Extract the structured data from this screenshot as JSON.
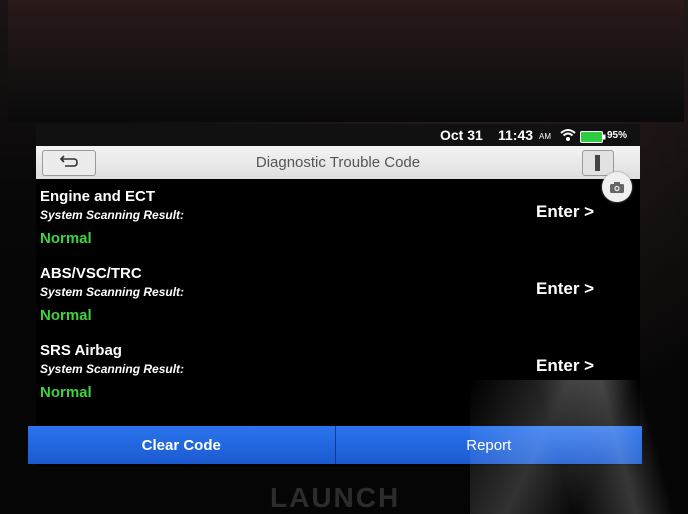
{
  "status": {
    "date": "Oct 31",
    "time": "11:43",
    "ampm": "AM",
    "battery": "95%",
    "wifi_icon": "wifi-icon",
    "battery_icon": "battery-icon"
  },
  "header": {
    "title": "Diagnostic Trouble Code",
    "back_icon": "back-arrow-icon",
    "menu_icon": "menu-icon",
    "camera_icon": "camera-icon"
  },
  "systems": [
    {
      "name": "Engine and ECT",
      "scan_label": "System Scanning Result:",
      "status": "Normal",
      "enter": "Enter >"
    },
    {
      "name": "ABS/VSC/TRC",
      "scan_label": "System Scanning Result:",
      "status": "Normal",
      "enter": "Enter >"
    },
    {
      "name": "SRS Airbag",
      "scan_label": "System Scanning Result:",
      "status": "Normal",
      "enter": "Enter >"
    }
  ],
  "actions": {
    "clear": "Clear Code",
    "report": "Report"
  },
  "brand": "LAUNCH",
  "colors": {
    "accent": "#1e63d9",
    "normal": "#3fd33f",
    "battery": "#2ecc40"
  }
}
